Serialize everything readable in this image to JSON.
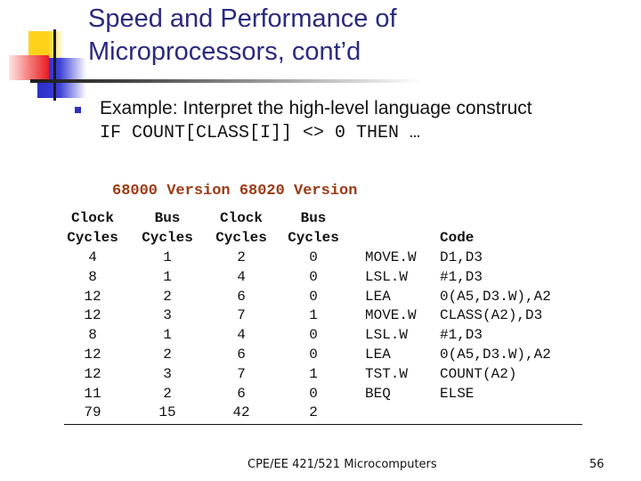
{
  "slide": {
    "title_line1": "Speed and Performance of",
    "title_line2": "Microprocessors, cont’d",
    "bullet_text": "Example: Interpret the high-level language construct",
    "construct": "IF COUNT[CLASS[I]] <> 0 THEN …",
    "versions_label": "68000 Version 68020 Version",
    "colors": {
      "title": "#2a2a80",
      "versions": "#9c3a14",
      "bullet": "#3030c0"
    }
  },
  "table": {
    "headers": [
      {
        "line1": "Clock",
        "line2": "Cycles"
      },
      {
        "line1": "Bus",
        "line2": "Cycles"
      },
      {
        "line1": "Clock",
        "line2": "Cycles"
      },
      {
        "line1": "Bus",
        "line2": "Cycles"
      },
      {
        "line1": "",
        "line2": ""
      },
      {
        "line1": "",
        "line2": "Code"
      }
    ],
    "rows": [
      {
        "clk68000": "4",
        "bus68000": "1",
        "clk68020": "2",
        "bus68020": "0",
        "op": "MOVE.W",
        "operand": "D1,D3"
      },
      {
        "clk68000": "8",
        "bus68000": "1",
        "clk68020": "4",
        "bus68020": "0",
        "op": "LSL.W",
        "operand": "#1,D3"
      },
      {
        "clk68000": "12",
        "bus68000": "2",
        "clk68020": "6",
        "bus68020": "0",
        "op": "LEA",
        "operand": "0(A5,D3.W),A2"
      },
      {
        "clk68000": "12",
        "bus68000": "3",
        "clk68020": "7",
        "bus68020": "1",
        "op": "MOVE.W",
        "operand": "CLASS(A2),D3"
      },
      {
        "clk68000": "8",
        "bus68000": "1",
        "clk68020": "4",
        "bus68020": "0",
        "op": "LSL.W",
        "operand": "#1,D3"
      },
      {
        "clk68000": "12",
        "bus68000": "2",
        "clk68020": "6",
        "bus68020": "0",
        "op": "LEA",
        "operand": "0(A5,D3.W),A2"
      },
      {
        "clk68000": "12",
        "bus68000": "3",
        "clk68020": "7",
        "bus68020": "1",
        "op": "TST.W",
        "operand": "COUNT(A2)"
      },
      {
        "clk68000": "11",
        "bus68000": "2",
        "clk68020": "6",
        "bus68020": "0",
        "op": "BEQ",
        "operand": "ELSE"
      }
    ],
    "totals": {
      "clk68000": "79",
      "bus68000": "15",
      "clk68020": "42",
      "bus68020": "2"
    }
  },
  "footer": {
    "course": "CPE/EE 421/521 Microcomputers",
    "page_number": "56"
  }
}
